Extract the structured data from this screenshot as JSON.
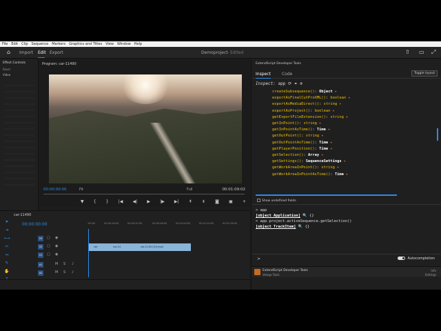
{
  "menu": [
    "File",
    "Edit",
    "Clip",
    "Sequence",
    "Markers",
    "Graphics and Titles",
    "View",
    "Window",
    "Help"
  ],
  "header": {
    "import": "Import",
    "edit": "Edit",
    "export": "Export",
    "project": "Demoproject",
    "edited": "- Edited"
  },
  "effect_controls": {
    "title": "Effect Controls",
    "source": "Sourc",
    "video": "Video"
  },
  "program": {
    "title": "Program: car-11490",
    "tc_left": "00:00:00:00",
    "fit": "Fit",
    "full": "Full",
    "tc_right": "00:01:09:02"
  },
  "timeline": {
    "title": "car-11490",
    "tc": "00:00:00:00",
    "ticks": [
      ":00:00",
      "00:00:16:00",
      "00:00:32:00",
      "00:00:48:00",
      "00:01:04:00",
      "00:01:20:00",
      "00:01:36:00"
    ],
    "tracks": [
      "V3",
      "V2",
      "V1",
      "A1",
      "A2"
    ],
    "clips": [
      "car",
      "car-14",
      "car-11154 [V].mp4"
    ],
    "panel_tc": "00:00:00"
  },
  "es": {
    "title": "ExtendScript Developer Tools",
    "tab_inspect": "Inspect",
    "tab_code": "Code",
    "toggle": "Toggle layout",
    "inspect_label": "Inspect:",
    "inspect_target": "app",
    "members": [
      {
        "name": "createSubsequence()",
        "type": "Object",
        "strong": true
      },
      {
        "name": "exportAsFinalCutProXML()",
        "type": "boolean",
        "strong": false
      },
      {
        "name": "exportAsMediaDirect()",
        "type": "string",
        "strong": false
      },
      {
        "name": "exportAsProject()",
        "type": "boolean",
        "strong": false
      },
      {
        "name": "getExportFileExtension()",
        "type": "string",
        "strong": false
      },
      {
        "name": "getInPoint()",
        "type": "string",
        "strong": false
      },
      {
        "name": "getInPointAsTime()",
        "type": "Time",
        "strong": true
      },
      {
        "name": "getOutPoint()",
        "type": "string",
        "strong": false
      },
      {
        "name": "getOutPointAsTime()",
        "type": "Time",
        "strong": true
      },
      {
        "name": "getPlayerPosition()",
        "type": "Time",
        "strong": true
      },
      {
        "name": "getSelection()",
        "type": "Array",
        "strong": true
      },
      {
        "name": "getSettings()",
        "type": "SequenceSettings",
        "strong": true
      },
      {
        "name": "getWorkAreaInPoint()",
        "type": "string",
        "strong": false
      },
      {
        "name": "getWorkAreaInPointAsTime()",
        "type": "Time",
        "strong": true
      }
    ],
    "show_undefined": "Show undefined fields",
    "console": {
      "l1": "> app",
      "l2": "[object Application]",
      "l3": "> app.project.activeSequence.getSelection()",
      "l4": "[object TrackItem]",
      "braces": "{}"
    },
    "prompt": ">",
    "autocompletion": "Autocompletion",
    "footer": {
      "name": "ExtendScript Developer Tools",
      "vendor": "Velaqo Tools",
      "info": "Info",
      "settings": "Settings"
    }
  }
}
